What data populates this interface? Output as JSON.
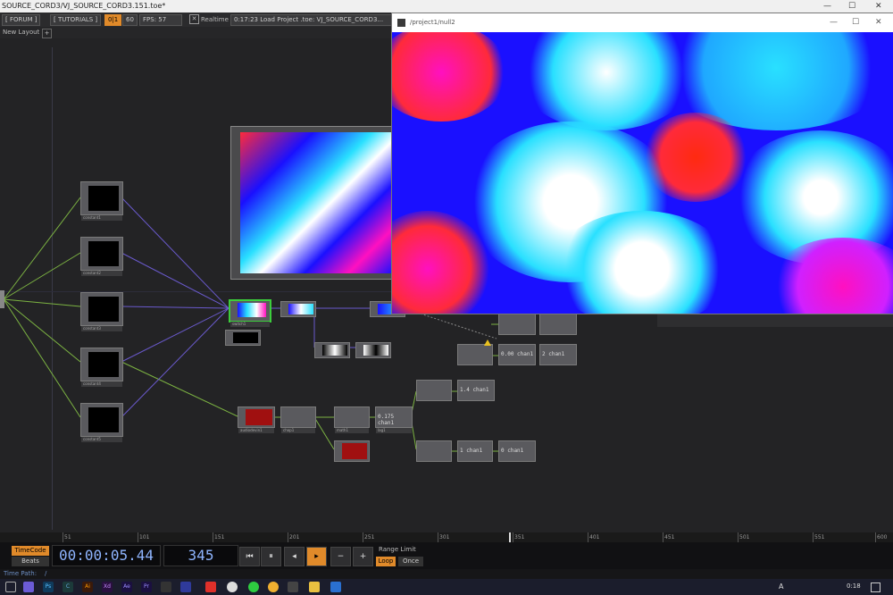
{
  "window": {
    "title": "SOURCE_CORD3/VJ_SOURCE_CORD3.151.toe*",
    "minimize": "—",
    "maximize": "☐",
    "close": "✕"
  },
  "menubar": {
    "forum": "[ FORUM ]",
    "tutorials": "[ TUTORIALS ]",
    "pause_indicator": "0|1",
    "fps_target": "60",
    "fps_label": "FPS:",
    "fps_value": "57",
    "realtime_label": "Realtime",
    "status": "0:17:23 Load Project .toe: VJ_SOURCE_CORD3..."
  },
  "layout": {
    "tab": "New Layout",
    "add": "+"
  },
  "output_window": {
    "title": "/project1/null2",
    "minimize": "—",
    "maximize": "☐",
    "close": "✕"
  },
  "nodes": [
    {
      "id": "constant1",
      "label": "constant1"
    },
    {
      "id": "constant2",
      "label": "constant2"
    },
    {
      "id": "constant3",
      "label": "constant3"
    },
    {
      "id": "constant4",
      "label": "constant4"
    },
    {
      "id": "constant5",
      "label": "constant5"
    },
    {
      "id": "switch1",
      "label": "switch1"
    },
    {
      "id": "chop",
      "label": "chop1"
    },
    {
      "id": "level1",
      "label": "level1"
    },
    {
      "id": "audio",
      "label": "audiodevin1"
    },
    {
      "id": "math1",
      "label": "math1"
    },
    {
      "id": "lag1",
      "label": "lag1"
    },
    {
      "id": "null2",
      "label": "null2"
    }
  ],
  "chop_text": {
    "c1": "2 chan1",
    "c2": "1.4 chan1",
    "c3": "0.175 chan1",
    "c4": "0 chan1",
    "c5": "1 chan1",
    "c6": "0.00 chan1"
  },
  "ruler": [
    "51",
    "101",
    "151",
    "201",
    "251",
    "301",
    "351",
    "401",
    "451",
    "501",
    "551",
    "600"
  ],
  "transport": {
    "timecode_btn": "TimeCode",
    "beats_btn": "Beats",
    "timecode": "00:00:05.44",
    "frame": "345",
    "range_label": "Range Limit",
    "loop": "Loop",
    "once": "Once",
    "buttons": [
      "⏮",
      "⏸",
      "◂",
      "▸",
      "−",
      "+"
    ]
  },
  "timepath": {
    "label": "Time Path:",
    "value": "/"
  },
  "taskbar": {
    "time": "0:18",
    "lang": "A"
  },
  "colors": {
    "accent": "#e08a2a",
    "wire_green": "#7cb342",
    "wire_purple": "#6a5acd"
  }
}
